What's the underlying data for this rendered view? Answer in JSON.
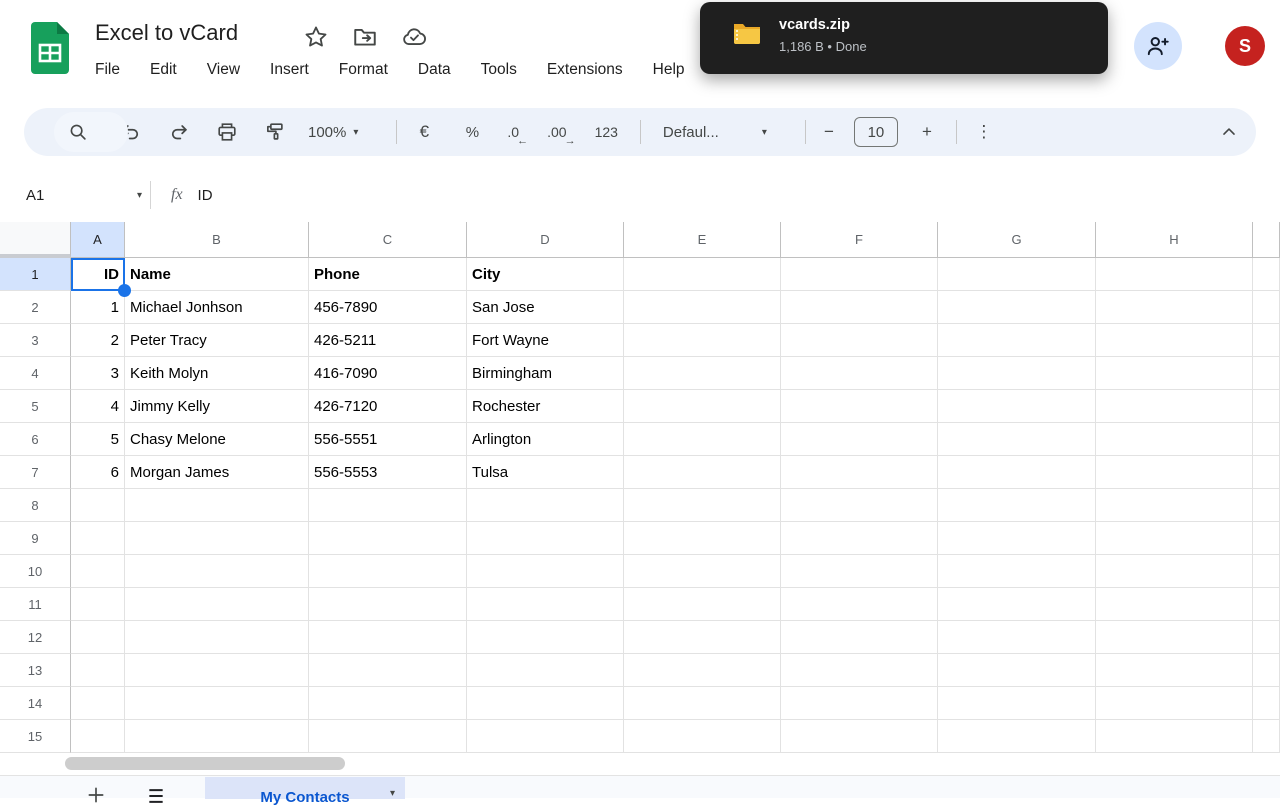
{
  "header": {
    "title": "Excel to vCard",
    "menu_items": [
      "File",
      "Edit",
      "View",
      "Insert",
      "Format",
      "Data",
      "Tools",
      "Extensions",
      "Help"
    ],
    "avatar_letter": "S"
  },
  "toast": {
    "filename": "vcards.zip",
    "detail": "1,186 B • Done"
  },
  "toolbar": {
    "zoom_value": "100%",
    "currency_label": "€",
    "percent_label": "%",
    "decrease_decimal_label": ".0",
    "decrease_decimal_arrow": "←",
    "increase_decimal_label": ".00",
    "increase_decimal_arrow": "→",
    "more_formats_label": "123",
    "font_name": "Defaul...",
    "font_size": "10",
    "minus_glyph": "−",
    "plus_glyph": "+",
    "overflow_glyph": "⋮",
    "dropdown_glyph": "▾"
  },
  "formula_bar": {
    "cell_reference": "A1",
    "fx_label": "fx",
    "value": "ID"
  },
  "sheet": {
    "column_headers": [
      "A",
      "B",
      "C",
      "D",
      "E",
      "F",
      "G",
      "H"
    ],
    "row_headers": [
      "1",
      "2",
      "3",
      "4",
      "5",
      "6",
      "7",
      "8",
      "9",
      "10",
      "11",
      "12",
      "13",
      "14",
      "15"
    ],
    "selected_cell": "A1",
    "cells": [
      [
        "ID",
        "Name",
        "Phone",
        "City"
      ],
      [
        "1",
        "Michael Jonhson",
        "456-7890",
        "San Jose"
      ],
      [
        "2",
        "Peter Tracy",
        "426-5211",
        "Fort Wayne"
      ],
      [
        "3",
        "Keith Molyn",
        "416-7090",
        "Birmingham"
      ],
      [
        "4",
        "Jimmy Kelly",
        "426-7120",
        "Rochester"
      ],
      [
        "5",
        "Chasy Melone",
        "556-5551",
        "Arlington"
      ],
      [
        "6",
        "Morgan James",
        "556-5553",
        "Tulsa"
      ]
    ]
  },
  "sheet_tabs": {
    "active_tab": "My Contacts"
  },
  "colors": {
    "accent_blue": "#1a73e8",
    "selected_header_bg": "#d3e3fd",
    "toolbar_bg": "#edf2fa",
    "avatar_bg": "#c5221f",
    "share_button_bg": "#d3e3fd",
    "toast_bg": "#1f1f1f",
    "active_tab_text": "#0b57d0",
    "logo_green": "#17a05c",
    "folder_icon_yellow": "#f6c744"
  }
}
